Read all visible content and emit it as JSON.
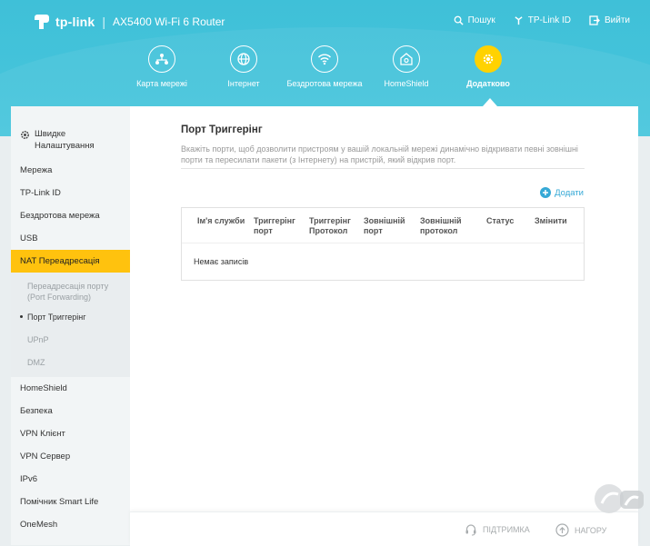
{
  "header": {
    "brand": "tp-link",
    "separator": "|",
    "model": "AX5400 Wi-Fi 6 Router",
    "links": [
      {
        "label": "Пошук",
        "icon": "search-icon"
      },
      {
        "label": "TP-Link ID",
        "icon": "tplink-id-icon"
      },
      {
        "label": "Вийти",
        "icon": "logout-icon"
      }
    ]
  },
  "nav": [
    {
      "label": "Карта мережі",
      "icon": "network-map-icon"
    },
    {
      "label": "Інтернет",
      "icon": "globe-icon"
    },
    {
      "label": "Бездротова мережа",
      "icon": "wifi-icon"
    },
    {
      "label": "HomeShield",
      "icon": "homeshield-icon"
    },
    {
      "label": "Додатково",
      "icon": "gear-icon",
      "active": true
    }
  ],
  "sidebar": {
    "quick_setup": "Швидке Налаштування",
    "items_top": [
      "Мережа",
      "TP-Link ID",
      "Бездротова мережа",
      "USB",
      "NAT Переадресація"
    ],
    "sub_items": [
      "Переадресація порту (Port Forwarding)",
      "Порт Триггерінг",
      "UPnP",
      "DMZ"
    ],
    "items_bottom": [
      "HomeShield",
      "Безпека",
      "VPN Клієнт",
      "VPN Сервер",
      "IPv6",
      "Помічник Smart Life",
      "OneMesh"
    ]
  },
  "content": {
    "title": "Порт Триггерінг",
    "description": "Вкажіть порти, щоб дозволити пристроям у вашій локальній мережі динамічно відкривати певні зовнішні порти та пересилати пакети (з Інтернету) на пристрій, який відкрив порт.",
    "add_label": "Додати",
    "columns": [
      "Ім'я служби",
      "Триггерінг порт",
      "Триггерінг Протокол",
      "Зовнішній порт",
      "Зовнішній протокол",
      "Статус",
      "Змінити"
    ],
    "empty_text": "Немає записів"
  },
  "footer": {
    "support": "ПІДТРИМКА",
    "back_to_top": "НАГОРУ"
  },
  "colors": {
    "header": "#45c4da",
    "accent": "#ffc20e",
    "link": "#36a9d6"
  }
}
